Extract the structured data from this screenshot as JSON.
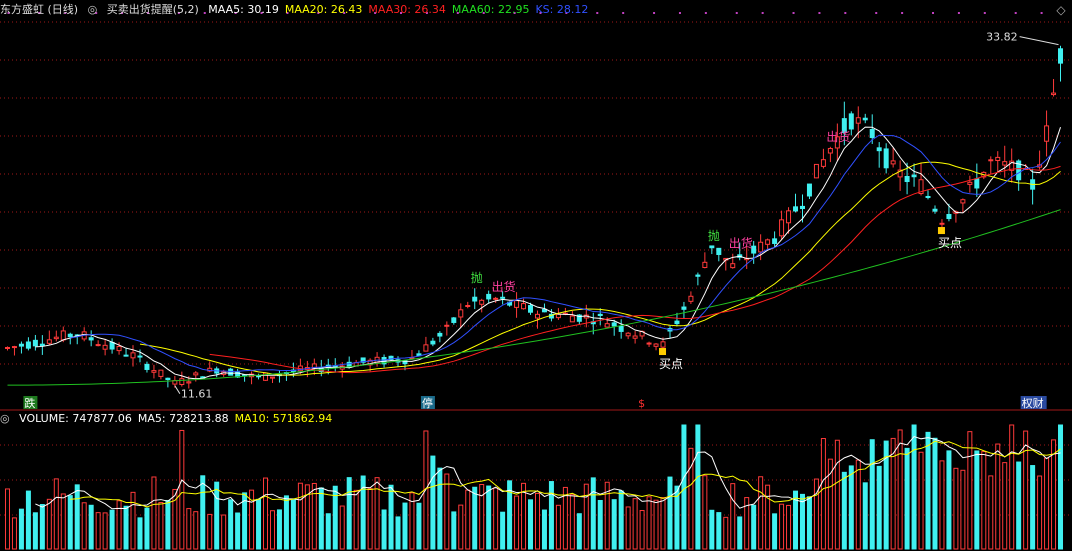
{
  "header": {
    "title": "东方盛虹 (日线)",
    "indicator": "买卖出货提醒(5,2)",
    "toggle_icon": "diamond-icon",
    "items": [
      {
        "label": "MAA5: 30.19",
        "color": "#ffffff"
      },
      {
        "label": "MAA20: 26.43",
        "color": "#ffff00"
      },
      {
        "label": "MAA30: 26.34",
        "color": "#ff2020"
      },
      {
        "label": "MAA60: 22.95",
        "color": "#20e020"
      },
      {
        "label": "KS: 28.12",
        "color": "#3050ff"
      }
    ]
  },
  "volume_header": {
    "items": [
      {
        "label": "VOLUME: 747877.06",
        "color": "#ffffff"
      },
      {
        "label": "MA5: 728213.88",
        "color": "#ffffff"
      },
      {
        "label": "MA10: 571862.94",
        "color": "#ffff00"
      }
    ]
  },
  "markers": {
    "high_price": "33.82",
    "low_price": "11.61",
    "signals": [
      {
        "text": "抛",
        "color": "#40e040",
        "ci": 67,
        "pos": "above"
      },
      {
        "text": "出货",
        "color": "#ff40a0",
        "ci": 70,
        "pos": "above"
      },
      {
        "text": "抛",
        "color": "#40e040",
        "ci": 101,
        "pos": "above"
      },
      {
        "text": "出货",
        "color": "#ff40a0",
        "ci": 104,
        "pos": "above"
      },
      {
        "text": "出货",
        "color": "#ff40a0",
        "ci": 118,
        "pos": "above"
      },
      {
        "text": "买点",
        "color": "#ffffff",
        "ci": 94,
        "pos": "below"
      },
      {
        "text": "买点",
        "color": "#ffffff",
        "ci": 134,
        "pos": "below"
      }
    ],
    "event_labels": [
      {
        "text": "跌",
        "bg": "#1e7a1e",
        "color": "#ffffff",
        "ci": 3
      },
      {
        "text": "停",
        "bg": "#1a6a8a",
        "color": "#ffffff",
        "ci": 60
      },
      {
        "text": "$",
        "bg": "#000000",
        "color": "#ff3030",
        "ci": 91
      },
      {
        "text": "权财",
        "bg": "#2a4aa0",
        "color": "#ffffff",
        "ci": 146
      }
    ]
  },
  "colors": {
    "up": "#ff3a3a",
    "down": "#40f0f0",
    "grid": "#a01818",
    "ma5": "#ffffff",
    "ma20": "#ffff00",
    "ma30": "#ff2020",
    "ma60": "#20c020",
    "ks": "#3050ff"
  }
}
